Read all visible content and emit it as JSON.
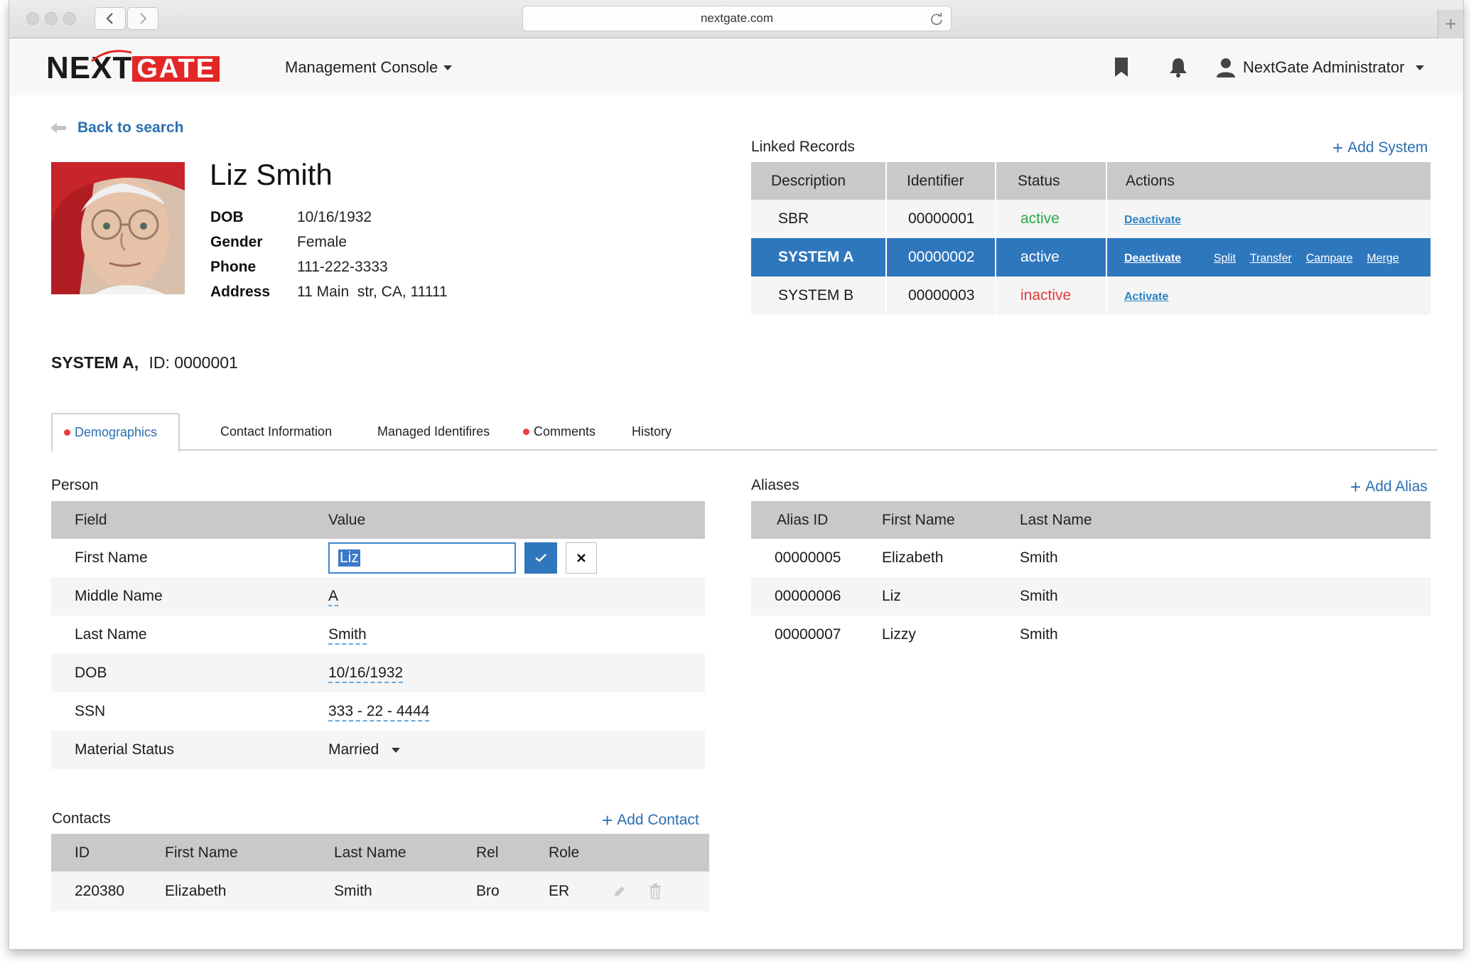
{
  "browser": {
    "url": "nextgate.com",
    "new_tab": "+"
  },
  "header": {
    "logo_next": "NEXT",
    "logo_gate": "GATE",
    "menu_label": "Management Console",
    "user_name": "NextGate Administrator"
  },
  "back_link": "Back to search",
  "patient": {
    "name": "Liz Smith",
    "fields": [
      {
        "label": "DOB",
        "value": "10/16/1932"
      },
      {
        "label": "Gender",
        "value": "Female"
      },
      {
        "label": "Phone",
        "value": "111-222-3333"
      },
      {
        "label": "Address",
        "value": "11 Main  str, CA, 11111"
      }
    ]
  },
  "linked_records": {
    "title": "Linked Records",
    "add_label": "Add System",
    "columns": [
      "Description",
      "Identifier",
      "Status",
      "Actions"
    ],
    "rows": [
      {
        "description": "SBR",
        "identifier": "00000001",
        "status": "active",
        "action": "Deactivate"
      },
      {
        "description": "SYSTEM A",
        "identifier": "00000002",
        "status": "active",
        "action": "Deactivate",
        "extra_actions": [
          "Split",
          "Transfer",
          "Campare",
          "Merge"
        ]
      },
      {
        "description": "SYSTEM B",
        "identifier": "00000003",
        "status": "inactive",
        "action": "Activate"
      }
    ]
  },
  "system_id": {
    "system": "SYSTEM A,",
    "id": "ID: 0000001"
  },
  "tabs": [
    "Demographics",
    "Contact Information",
    "Managed Identifires",
    "Comments",
    "History"
  ],
  "person": {
    "title": "Person",
    "columns": [
      "Field",
      "Value"
    ],
    "rows": [
      {
        "field": "First Name",
        "value": "Liz"
      },
      {
        "field": "Middle Name",
        "value": "A"
      },
      {
        "field": "Last Name",
        "value": "Smith"
      },
      {
        "field": "DOB",
        "value": "10/16/1932"
      },
      {
        "field": "SSN",
        "value": "333 - 22 - 4444"
      },
      {
        "field": "Material Status",
        "value": "Married"
      }
    ]
  },
  "aliases": {
    "title": "Aliases",
    "add_label": "Add Alias",
    "columns": [
      "Alias ID",
      "First Name",
      "Last Name"
    ],
    "rows": [
      [
        "00000005",
        "Elizabeth",
        "Smith"
      ],
      [
        "00000006",
        "Liz",
        "Smith"
      ],
      [
        "00000007",
        "Lizzy",
        "Smith"
      ]
    ]
  },
  "contacts": {
    "title": "Contacts",
    "add_label": "Add Contact",
    "columns": [
      "ID",
      "First Name",
      "Last Name",
      "Rel",
      "Role"
    ],
    "rows": [
      [
        "220380",
        "Elizabeth",
        "Smith",
        "Bro",
        "ER"
      ]
    ]
  },
  "colors": {
    "accent": "#2f77bd",
    "link": "#2a6fb0",
    "active": "#2aa84a",
    "inactive": "#e03b3b",
    "brand_red": "#e32726"
  }
}
